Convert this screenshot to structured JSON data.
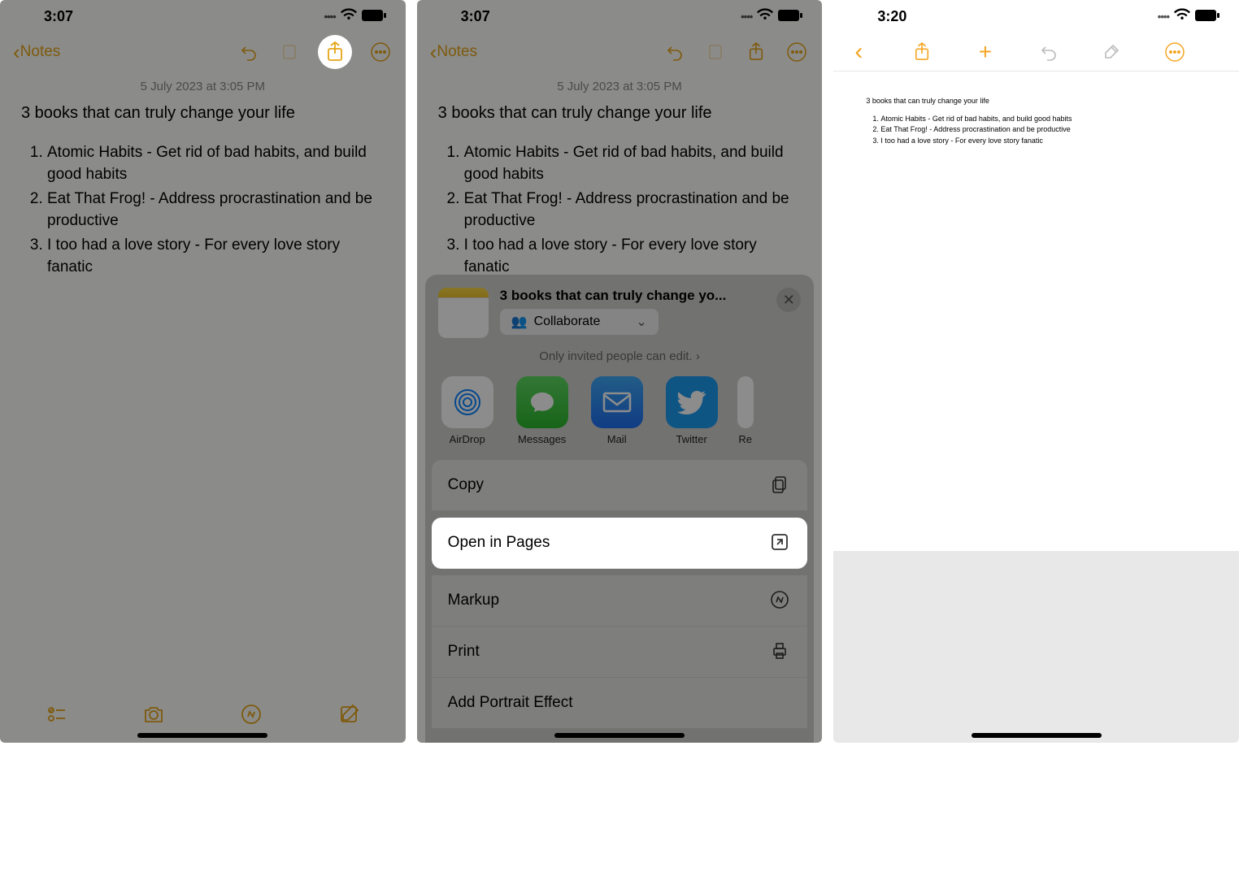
{
  "status": {
    "time1": "3:07",
    "time2": "3:07",
    "time3": "3:20"
  },
  "nav": {
    "back_label": "Notes"
  },
  "note": {
    "date": "5 July 2023 at 3:05 PM",
    "title": "3 books that can truly change your life",
    "items": [
      "Atomic Habits - Get rid of bad habits, and build good habits",
      "Eat That Frog! - Address procrastination and be productive",
      "I too had a love story - For every love story fanatic"
    ]
  },
  "sheet": {
    "title": "3 books that can truly change yo...",
    "collaborate": "Collaborate",
    "invite_note": "Only invited people can edit.",
    "apps": [
      {
        "name": "AirDrop"
      },
      {
        "name": "Messages"
      },
      {
        "name": "Mail"
      },
      {
        "name": "Twitter"
      },
      {
        "name": "Re"
      }
    ],
    "actions": {
      "copy": "Copy",
      "open_in_pages": "Open in Pages",
      "markup": "Markup",
      "print": "Print",
      "portrait": "Add Portrait Effect"
    }
  },
  "pages": {
    "title": "3 books that can truly change your life",
    "items": [
      "Atomic Habits - Get rid of bad habits, and build good habits",
      "Eat That Frog! - Address procrastination and be productive",
      "I too had a love story - For every love story fanatic"
    ]
  }
}
